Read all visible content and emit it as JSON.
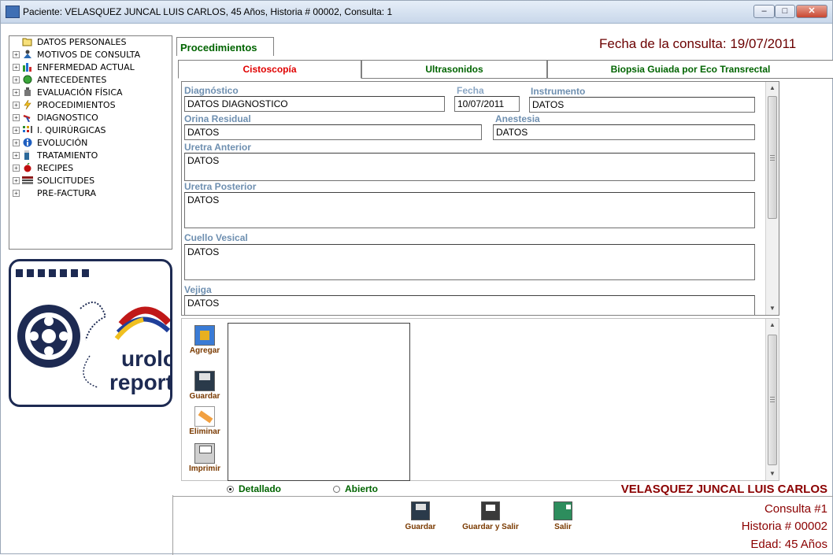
{
  "window": {
    "title": "Paciente: VELASQUEZ JUNCAL LUIS CARLOS, 45 Años, Historia # 00002, Consulta: 1"
  },
  "tree": {
    "items": [
      {
        "label": "DATOS PERSONALES",
        "icon": "folder-open-icon"
      },
      {
        "label": "MOTIVOS DE CONSULTA",
        "icon": "people-icon"
      },
      {
        "label": "ENFERMEDAD ACTUAL",
        "icon": "bar-chart-icon"
      },
      {
        "label": "ANTECEDENTES",
        "icon": "globe-icon"
      },
      {
        "label": "EVALUACIÓN FÍSICA",
        "icon": "scale-icon"
      },
      {
        "label": "PROCEDIMIENTOS",
        "icon": "lightning-icon"
      },
      {
        "label": "DIAGNOSTICO",
        "icon": "microscope-icon"
      },
      {
        "label": "I. QUIRÚRGICAS",
        "icon": "dots-grid-icon"
      },
      {
        "label": "EVOLUCIÓN",
        "icon": "info-globe-icon"
      },
      {
        "label": "TRATAMIENTO",
        "icon": "pill-bottle-icon"
      },
      {
        "label": "RECIPES",
        "icon": "apple-icon"
      },
      {
        "label": "SOLICITUDES",
        "icon": "form-icon"
      },
      {
        "label": "PRE-FACTURA",
        "icon": "none"
      }
    ]
  },
  "logo": {
    "line1": "urolo",
    "line2": "report"
  },
  "main": {
    "tab_label": "Procedimientos",
    "fecha_consulta": "Fecha de la consulta:  19/07/2011",
    "subtabs": [
      "Cistoscopía",
      "Ultrasonidos",
      "Biopsia Guiada por Eco Transrectal"
    ],
    "active_subtab": "Cistoscopía"
  },
  "form": {
    "diagnostico": {
      "label": "Diagnóstico",
      "value": "DATOS DIAGNOSTICO"
    },
    "fecha": {
      "label": "Fecha",
      "value": "10/07/2011"
    },
    "instrumento": {
      "label": "Instrumento",
      "value": "DATOS"
    },
    "orina_residual": {
      "label": "Orina Residual",
      "value": "DATOS"
    },
    "anestesia": {
      "label": "Anestesia",
      "value": "DATOS"
    },
    "uretra_anterior": {
      "label": "Uretra Anterior",
      "value": "DATOS"
    },
    "uretra_posterior": {
      "label": "Uretra Posterior",
      "value": "DATOS"
    },
    "cuello_vesical": {
      "label": "Cuello Vesical",
      "value": "DATOS"
    },
    "vejiga": {
      "label": "Vejiga",
      "value": "DATOS"
    }
  },
  "side_actions": {
    "agregar": "Agregar",
    "guardar": "Guardar",
    "eliminar": "Eliminar",
    "imprimir": "Imprimir"
  },
  "report_mode": {
    "detallado": "Detallado",
    "abierto": "Abierto",
    "selected": "Detallado"
  },
  "footer": {
    "patient_name": "VELASQUEZ JUNCAL LUIS CARLOS",
    "consulta": "Consulta #1",
    "historia": "Historia # 00002",
    "edad": "Edad: 45 Años",
    "guardar": "Guardar",
    "guardar_salir": "Guardar y Salir",
    "salir": "Salir"
  },
  "colors": {
    "accent_green": "#006400",
    "accent_red": "#e00000",
    "info_maroon": "#8b0000",
    "label_blue": "#6e8fb0"
  }
}
